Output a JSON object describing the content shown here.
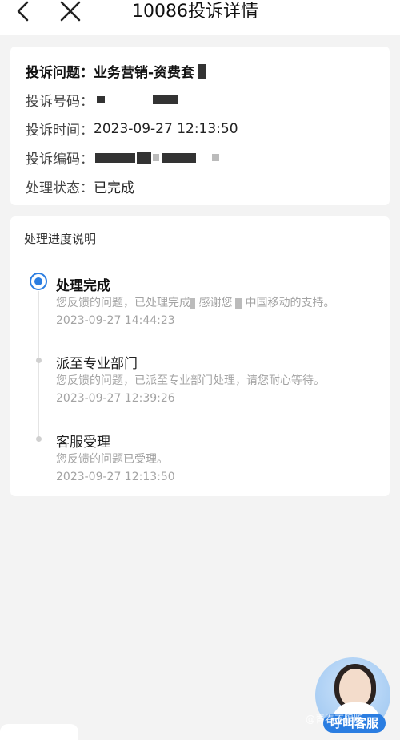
{
  "header": {
    "title": "10086投诉详情",
    "back_icon": "chevron-left-icon",
    "close_icon": "close-icon"
  },
  "info": {
    "issue_label": "投诉问题：",
    "issue_value": "业务营销-资费套",
    "number_label": "投诉号码：",
    "time_label": "投诉时间：",
    "time_value": "2023-09-27 12:13:50",
    "code_label": "投诉编码：",
    "status_label": "处理状态：",
    "status_value": "已完成"
  },
  "progress": {
    "title": "处理进度说明",
    "steps": [
      {
        "title": "处理完成",
        "desc_a": "您反馈的问题，已处理完成",
        "desc_b": "感谢您",
        "desc_c": "中国移动的支持。",
        "time": "2023-09-27 14:44:23",
        "active": true
      },
      {
        "title": "派至专业部门",
        "desc": "您反馈的问题，已派至专业部门处理，请您耐心等待。",
        "time": "2023-09-27 12:39:26",
        "active": false
      },
      {
        "title": "客服受理",
        "desc": "您反馈的问题已受理。",
        "time": "2023-09-27 12:13:50",
        "active": false
      }
    ]
  },
  "floating": {
    "label": "呼叫客服",
    "watermark": "@青春不限版"
  },
  "colors": {
    "accent": "#2a7de1",
    "background": "#f3f3f3",
    "card": "#ffffff",
    "muted_text": "#a3a3a3"
  }
}
